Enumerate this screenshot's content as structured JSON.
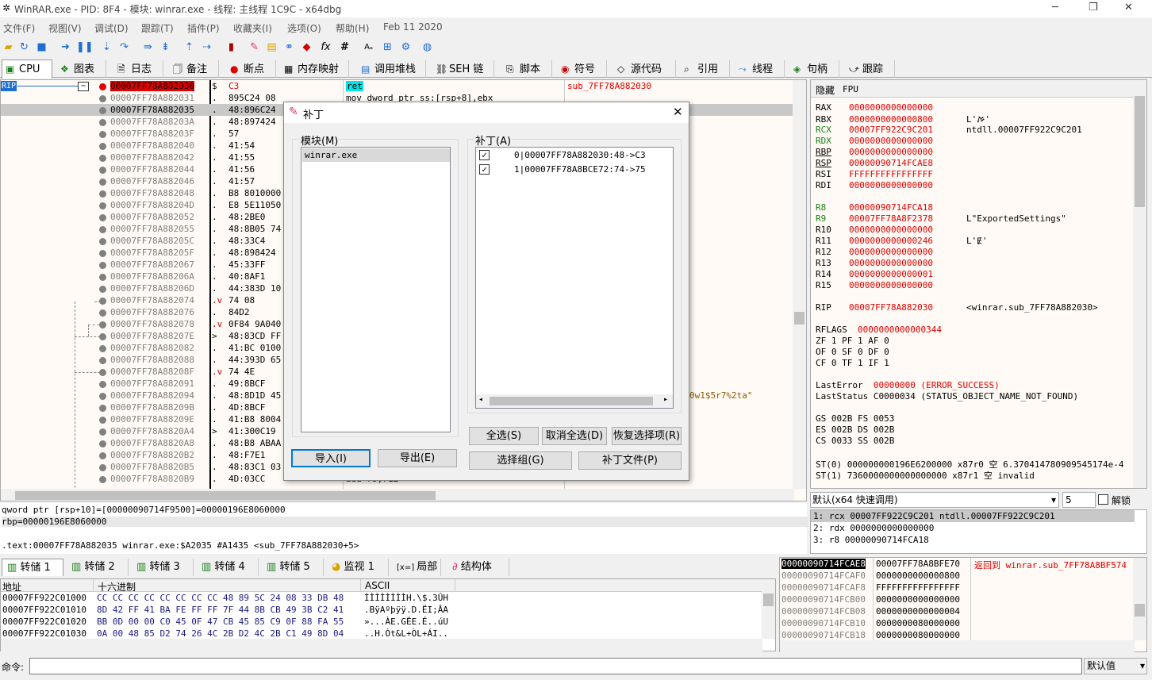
{
  "title": {
    "text": "WinRAR.exe - PID: 8F4 - 模块: winrar.exe - 线程: 主线程 1C9C - x64dbg"
  },
  "menu": [
    "文件(F)",
    "视图(V)",
    "调试(D)",
    "跟踪(T)",
    "插件(P)",
    "收藏夹(I)",
    "选项(O)",
    "帮助(H)",
    "Feb 11 2020"
  ],
  "tabs": [
    "CPU",
    "图表",
    "日志",
    "备注",
    "断点",
    "内存映射",
    "调用堆栈",
    "SEH 链",
    "脚本",
    "符号",
    "源代码",
    "引用",
    "线程",
    "句柄",
    "跟踪"
  ],
  "disasm": {
    "rip_label": "RIP",
    "rows": [
      {
        "addr": "00007FF78A882030",
        "mark": "$",
        "bytes": "C3"
      },
      {
        "addr": "00007FF78A882031",
        "mark": ".",
        "bytes": "895C24 08"
      },
      {
        "addr": "00007FF78A882035",
        "mark": ".",
        "bytes": "48:896C24"
      },
      {
        "addr": "00007FF78A88203A",
        "mark": ".",
        "bytes": "48:897424"
      },
      {
        "addr": "00007FF78A88203F",
        "mark": ".",
        "bytes": "57"
      },
      {
        "addr": "00007FF78A882040",
        "mark": ".",
        "bytes": "41:54"
      },
      {
        "addr": "00007FF78A882042",
        "mark": ".",
        "bytes": "41:55"
      },
      {
        "addr": "00007FF78A882044",
        "mark": ".",
        "bytes": "41:56"
      },
      {
        "addr": "00007FF78A882046",
        "mark": ".",
        "bytes": "41:57"
      },
      {
        "addr": "00007FF78A882048",
        "mark": ".",
        "bytes": "B8 8010000"
      },
      {
        "addr": "00007FF78A88204D",
        "mark": ".",
        "bytes": "E8 5E11050"
      },
      {
        "addr": "00007FF78A882052",
        "mark": ".",
        "bytes": "48:2BE0"
      },
      {
        "addr": "00007FF78A882055",
        "mark": ".",
        "bytes": "48:8B05 74"
      },
      {
        "addr": "00007FF78A88205C",
        "mark": ".",
        "bytes": "48:33C4"
      },
      {
        "addr": "00007FF78A88205F",
        "mark": ".",
        "bytes": "48:898424"
      },
      {
        "addr": "00007FF78A882067",
        "mark": ".",
        "bytes": "45:33FF"
      },
      {
        "addr": "00007FF78A88206A",
        "mark": ".",
        "bytes": "40:8AF1"
      },
      {
        "addr": "00007FF78A88206D",
        "mark": ".",
        "bytes": "44:383D 10"
      },
      {
        "addr": "00007FF78A882074",
        "mark": ".v",
        "bytes": "74 08"
      },
      {
        "addr": "00007FF78A882076",
        "mark": ".",
        "bytes": "84D2"
      },
      {
        "addr": "00007FF78A882078",
        "mark": ".v",
        "bytes": "0F84 9A040"
      },
      {
        "addr": "00007FF78A88207E",
        "mark": ">",
        "bytes": "48:83CD FF"
      },
      {
        "addr": "00007FF78A882082",
        "mark": ".",
        "bytes": "41:BC 0100"
      },
      {
        "addr": "00007FF78A882088",
        "mark": ".",
        "bytes": "44:393D 65"
      },
      {
        "addr": "00007FF78A88208F",
        "mark": ".v",
        "bytes": "74 4E"
      },
      {
        "addr": "00007FF78A882091",
        "mark": ".",
        "bytes": "49:8BCF"
      },
      {
        "addr": "00007FF78A882094",
        "mark": ".",
        "bytes": "48:8D1D 45"
      },
      {
        "addr": "00007FF78A88209B",
        "mark": ".",
        "bytes": "4D:8BCF"
      },
      {
        "addr": "00007FF78A88209E",
        "mark": ".",
        "bytes": "41:B8 8004"
      },
      {
        "addr": "00007FF78A8820A4",
        "mark": ">",
        "bytes": "41:300C19"
      },
      {
        "addr": "00007FF78A8820A8",
        "mark": ".",
        "bytes": "48:B8 ABAA"
      },
      {
        "addr": "00007FF78A8820B2",
        "mark": ".",
        "bytes": "48:F7E1"
      },
      {
        "addr": "00007FF78A8820B5",
        "mark": ".",
        "bytes": "48:83C1 03"
      },
      {
        "addr": "00007FF78A8820B9",
        "mark": ".",
        "bytes": "4D:03CC"
      }
    ],
    "instr_ret": "ret",
    "instr_mov": "mov dword ptr ss:[rsp+8],ebx",
    "instr_last": "add r9,r12",
    "comment_label": "sub_7FF78A882030",
    "comment_string": "0w1$5r7%2ta\""
  },
  "info": {
    "line1": "qword ptr [rsp+10]=[00000090714F9500]=00000196E8060000",
    "line2": "rbp=00000196E8060000",
    "line3": ".text:00007FF78A882035 winrar.exe:$A2035 #A1435 <sub_7FF78A882030+5>"
  },
  "regs": {
    "header_hide": "隐藏",
    "header_fpu": "FPU",
    "rows": [
      {
        "n": "RAX",
        "v": "0000000000000000",
        "c": ""
      },
      {
        "n": "RBX",
        "v": "0000000000000800",
        "c": "L'ࠀ'"
      },
      {
        "n": "RCX",
        "v": "00007FF922C9C201",
        "c": "ntdll.00007FF922C9C201"
      },
      {
        "n": "RDX",
        "v": "0000000000000000",
        "c": ""
      },
      {
        "n": "RBP",
        "v": "0000000000000000",
        "c": ""
      },
      {
        "n": "RSP",
        "v": "00000090714FCAE8",
        "c": ""
      },
      {
        "n": "RSI",
        "v": "FFFFFFFFFFFFFFFF",
        "c": ""
      },
      {
        "n": "RDI",
        "v": "0000000000000000",
        "c": ""
      },
      {
        "n": "R8",
        "v": "00000090714FCA18",
        "c": ""
      },
      {
        "n": "R9",
        "v": "00007FF78A8F2378",
        "c": "L\"ExportedSettings\""
      },
      {
        "n": "R10",
        "v": "0000000000000000",
        "c": ""
      },
      {
        "n": "R11",
        "v": "0000000000000246",
        "c": "L'Ɇ'"
      },
      {
        "n": "R12",
        "v": "0000000000000000",
        "c": ""
      },
      {
        "n": "R13",
        "v": "0000000000000000",
        "c": ""
      },
      {
        "n": "R14",
        "v": "0000000000000001",
        "c": ""
      },
      {
        "n": "R15",
        "v": "0000000000000000",
        "c": ""
      },
      {
        "n": "RIP",
        "v": "00007FF78A882030",
        "c": "<winrar.sub_7FF78A882030>"
      }
    ],
    "rflags_label": "RFLAGS",
    "rflags": "0000000000000344",
    "flags1": "ZF 1  PF 1  AF 0",
    "flags2": "OF 0  SF 0  DF 0",
    "flags3": "CF 0  TF 1  IF 1",
    "lasterror_label": "LastError",
    "lasterror": "00000000 (ERROR_SUCCESS)",
    "laststatus": "LastStatus C0000034 (STATUS_OBJECT_NAME_NOT_FOUND)",
    "seg1": "GS 002B  FS 0053",
    "seg2": "ES 002B  DS 002B",
    "seg3": "CS 0033  SS 002B",
    "st0": "ST(0) 000000000196E6200000 x87r0 空 6.370414780909545174e-4",
    "st1": "ST(1) 7360000000000000000 x87r1 空 invalid"
  },
  "callconv": {
    "label": "默认(x64 快速调用)",
    "count": "5",
    "unlock": "解锁",
    "args": [
      "1: rcx 00007FF922C9C201 ntdll.00007FF922C9C201",
      "2: rdx 0000000000000000",
      "3: r8 00000090714FCA18"
    ]
  },
  "bottom_tabs": [
    "转储 1",
    "转储 2",
    "转储 3",
    "转储 4",
    "转储 5",
    "监视 1",
    "局部",
    "结构体"
  ],
  "dump": {
    "headers": [
      "地址",
      "十六进制",
      "ASCII"
    ],
    "rows": [
      {
        "a": "00007FF922C01000",
        "h": "CC CC CC CC CC CC CC CC 48 89 5C 24 08 33 DB 48",
        "s": "ÌÌÌÌÌÌÌÌH.\\$.3ÛH"
      },
      {
        "a": "00007FF922C01010",
        "h": "8D 42 FF 41 BA FE FF FF 7F 44 8B CB 49 3B C2 41",
        "s": ".BÿAºþÿÿ.D.ËI;ÂA"
      },
      {
        "a": "00007FF922C01020",
        "h": "BB 0D 00 00 C0 45 0F 47 CB 45 85 C9 0F 88 FA 55",
        "s": "»...ÀE.GËE.É..úU"
      },
      {
        "a": "00007FF922C01030",
        "h": "0A 00 48 85 D2 74 26 4C 2B D2 4C 2B C1 49 8D 04",
        "s": "..H.Òt&L+ÒL+ÁI.."
      }
    ]
  },
  "stack": {
    "rows": [
      {
        "a": "00000090714FCAE8",
        "v": "00007FF78A8BFE70",
        "c": "返回到 winrar.sub_7FF78A8BF574"
      },
      {
        "a": "00000090714FCAF0",
        "v": "0000000000000800",
        "c": ""
      },
      {
        "a": "00000090714FCAF8",
        "v": "FFFFFFFFFFFFFFFF",
        "c": ""
      },
      {
        "a": "00000090714FCB00",
        "v": "0000000000000000",
        "c": ""
      },
      {
        "a": "00000090714FCB08",
        "v": "0000000000000004",
        "c": ""
      },
      {
        "a": "00000090714FCB10",
        "v": "0000000080000000",
        "c": ""
      },
      {
        "a": "00000090714FCB18",
        "v": "0000000080000000",
        "c": ""
      }
    ]
  },
  "cmd": {
    "label": "命令:",
    "default": "默认值"
  },
  "dialog": {
    "title": "补丁",
    "modules_label": "模块(M)",
    "modules": [
      "winrar.exe"
    ],
    "patches_label": "补丁(A)",
    "patches": [
      "0|00007FF78A882030:48->C3",
      "1|00007FF78A8BCE72:74->75"
    ],
    "btn_import": "导入(I)",
    "btn_export": "导出(E)",
    "btn_selall": "全选(S)",
    "btn_deselall": "取消全选(D)",
    "btn_restore": "恢复选择项(R)",
    "btn_selgroup": "选择组(G)",
    "btn_patchfile": "补丁文件(P)"
  }
}
